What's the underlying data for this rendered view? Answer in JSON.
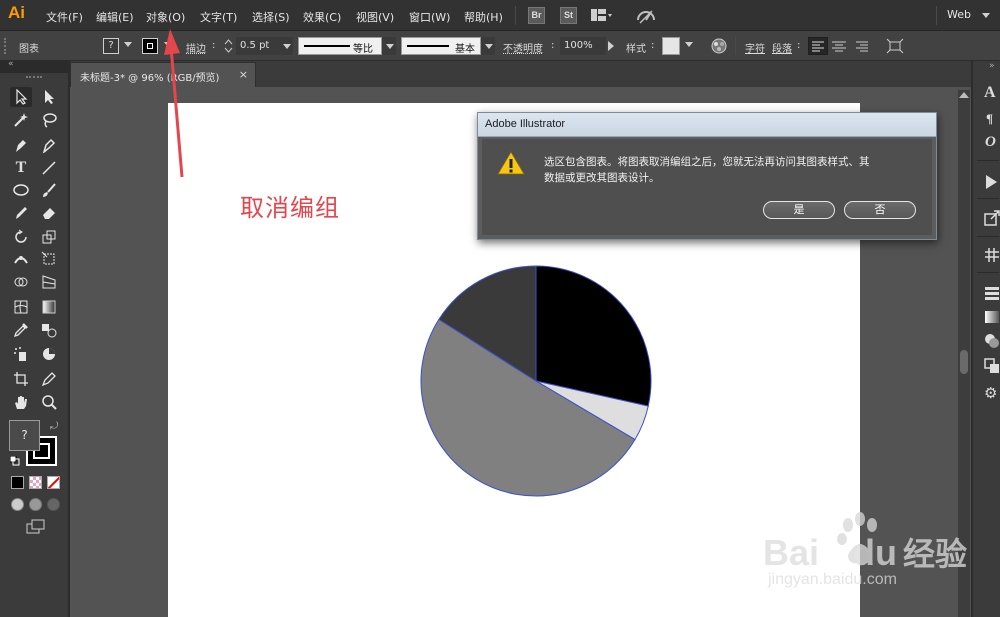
{
  "app": {
    "logo": "Ai",
    "menus": [
      "文件(F)",
      "编辑(E)",
      "对象(O)",
      "文字(T)",
      "选择(S)",
      "效果(C)",
      "视图(V)",
      "窗口(W)",
      "帮助(H)"
    ],
    "badges": [
      "Br",
      "St"
    ],
    "workspace": "Web"
  },
  "controlbar": {
    "selection_label": "图表",
    "fill_value": "?",
    "stroke_label": "描边",
    "stroke_weight": "0.5 pt",
    "profile_label": "等比",
    "brush_label": "基本",
    "opacity_label": "不透明度",
    "opacity_value": "100%",
    "style_label": "样式",
    "char_label": "字符",
    "para_label": "段落"
  },
  "document": {
    "tab_title": "未标题-3* @ 96% (RGB/预览)",
    "tab_close": "×"
  },
  "toolbar": {
    "fill_unknown": "?"
  },
  "annotation": {
    "text": "取消编组"
  },
  "dialog": {
    "title": "Adobe Illustrator",
    "message_line1": "选区包含图表。将图表取消编组之后，您就无法再访问其图表样式、其",
    "message_line2": "数据或更改其图表设计。",
    "yes_label": "是",
    "no_label": "否"
  },
  "watermark": {
    "brand": "Bai",
    "brand2": "du",
    "product": "经验",
    "url": "jingyan.baidu.com"
  },
  "chart_data": {
    "type": "pie",
    "slices": [
      {
        "value": 28.5,
        "color": "#000000"
      },
      {
        "value": 5,
        "color": "#dedede"
      },
      {
        "value": 50.5,
        "color": "#808080"
      },
      {
        "value": 16,
        "color": "#3a3a3a"
      }
    ]
  },
  "colors": {
    "accent_orange": "#ff9a00",
    "annotation_red": "#e5464c",
    "slice_outline": "#3b4fd0",
    "warning_yellow": "#f5c518"
  }
}
